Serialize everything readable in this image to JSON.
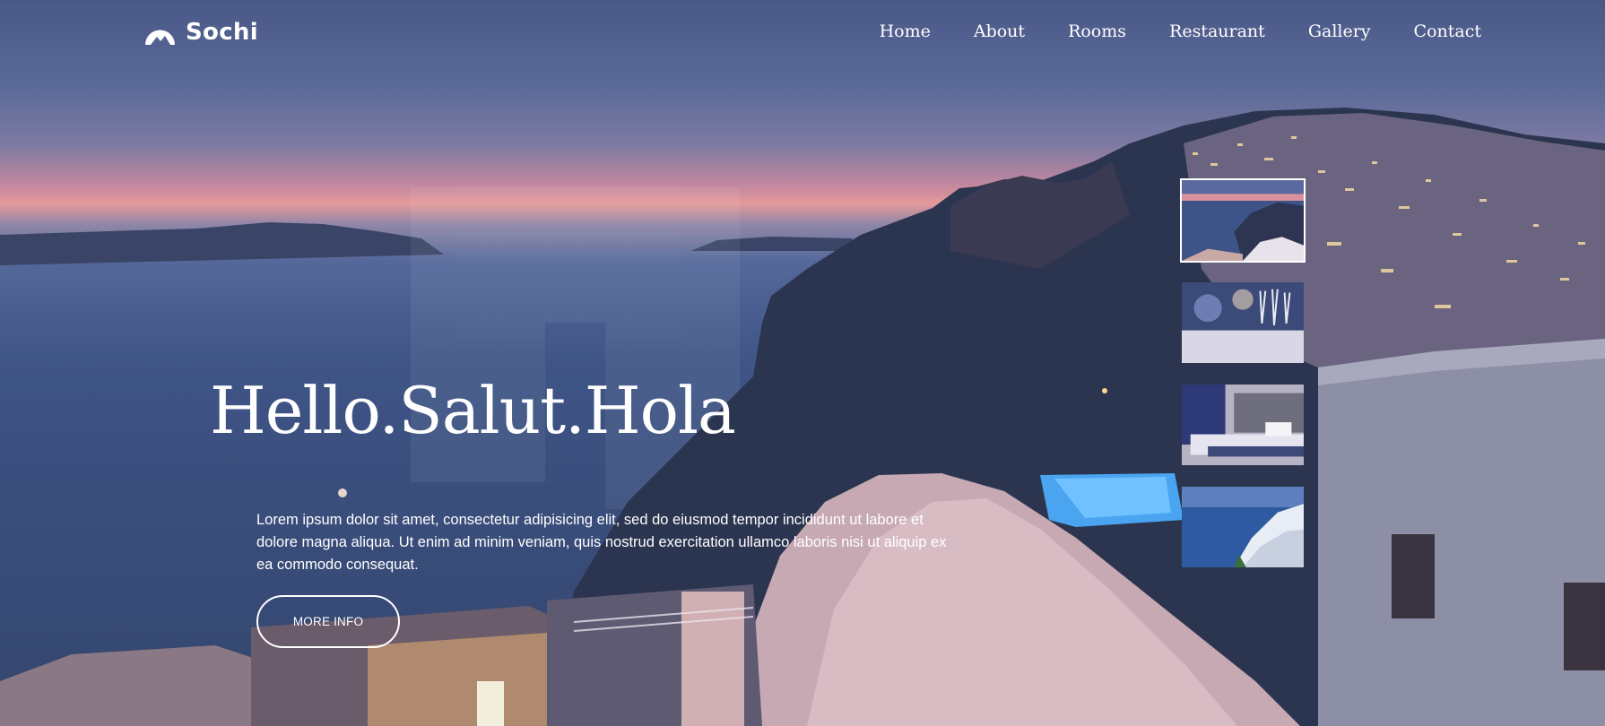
{
  "brand": {
    "name": "Sochi",
    "logo_icon": "mountain-logo-icon"
  },
  "nav": {
    "items": [
      {
        "label": "Home"
      },
      {
        "label": "About"
      },
      {
        "label": "Rooms"
      },
      {
        "label": "Restaurant"
      },
      {
        "label": "Gallery"
      },
      {
        "label": "Contact"
      }
    ]
  },
  "hero": {
    "headline": "Hello.Salut.Hola",
    "lead": "Lorem ipsum dolor sit amet, consectetur adipisicing elit, sed do eiusmod tempor incididunt ut labore et dolore magna aliqua. Ut enim ad minim veniam, quis nostrud exercitation ullamco laboris nisi ut aliquip ex ea commodo consequat.",
    "button_label": "MORE INFO"
  },
  "thumbnails": [
    {
      "subject": "sunset-coast",
      "active": true
    },
    {
      "subject": "restaurant-glasses",
      "active": false
    },
    {
      "subject": "hotel-room",
      "active": false
    },
    {
      "subject": "white-village",
      "active": false
    }
  ],
  "colors": {
    "text": "#ffffff",
    "sky_top": "#4a5887",
    "sunset_band": "#e49a9a",
    "sea": "#3b4f7e"
  }
}
